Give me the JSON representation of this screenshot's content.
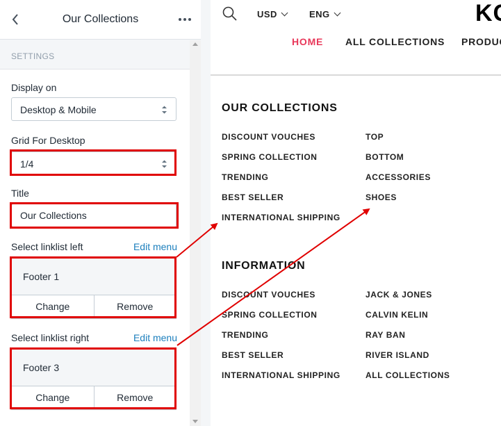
{
  "panel": {
    "title": "Our Collections",
    "section": "SETTINGS",
    "display_on": {
      "label": "Display on",
      "value": "Desktop & Mobile"
    },
    "grid": {
      "label": "Grid For Desktop",
      "value": "1/4"
    },
    "title_field": {
      "label": "Title",
      "value": "Our Collections"
    },
    "linklist_left": {
      "label": "Select linklist left",
      "edit": "Edit menu",
      "menu": "Footer 1",
      "change": "Change",
      "remove": "Remove"
    },
    "linklist_right": {
      "label": "Select linklist right",
      "edit": "Edit menu",
      "menu": "Footer 3",
      "change": "Change",
      "remove": "Remove"
    }
  },
  "store": {
    "currency": "USD",
    "language": "ENG",
    "logo": "KC",
    "nav": [
      "HOME",
      "ALL COLLECTIONS",
      "PRODUC"
    ],
    "collections": {
      "heading": "OUR COLLECTIONS",
      "left": [
        "DISCOUNT VOUCHES",
        "SPRING COLLECTION",
        "TRENDING",
        "BEST SELLER",
        "INTERNATIONAL SHIPPING"
      ],
      "right": [
        "TOP",
        "BOTTOM",
        "ACCESSORIES",
        "SHOES"
      ]
    },
    "information": {
      "heading": "INFORMATION",
      "left": [
        "DISCOUNT VOUCHES",
        "SPRING COLLECTION",
        "TRENDING",
        "BEST SELLER",
        "INTERNATIONAL SHIPPING"
      ],
      "right": [
        "JACK & JONES",
        "CALVIN KELIN",
        "RAY BAN",
        "RIVER ISLAND",
        "ALL COLLECTIONS"
      ]
    }
  },
  "colors": {
    "highlight": "#e00000",
    "accent": "#e8385a",
    "link": "#1c7fbd"
  },
  "icons": [
    "back-icon",
    "more-icon",
    "select-arrows-icon",
    "search-icon",
    "chevron-down-icon"
  ]
}
